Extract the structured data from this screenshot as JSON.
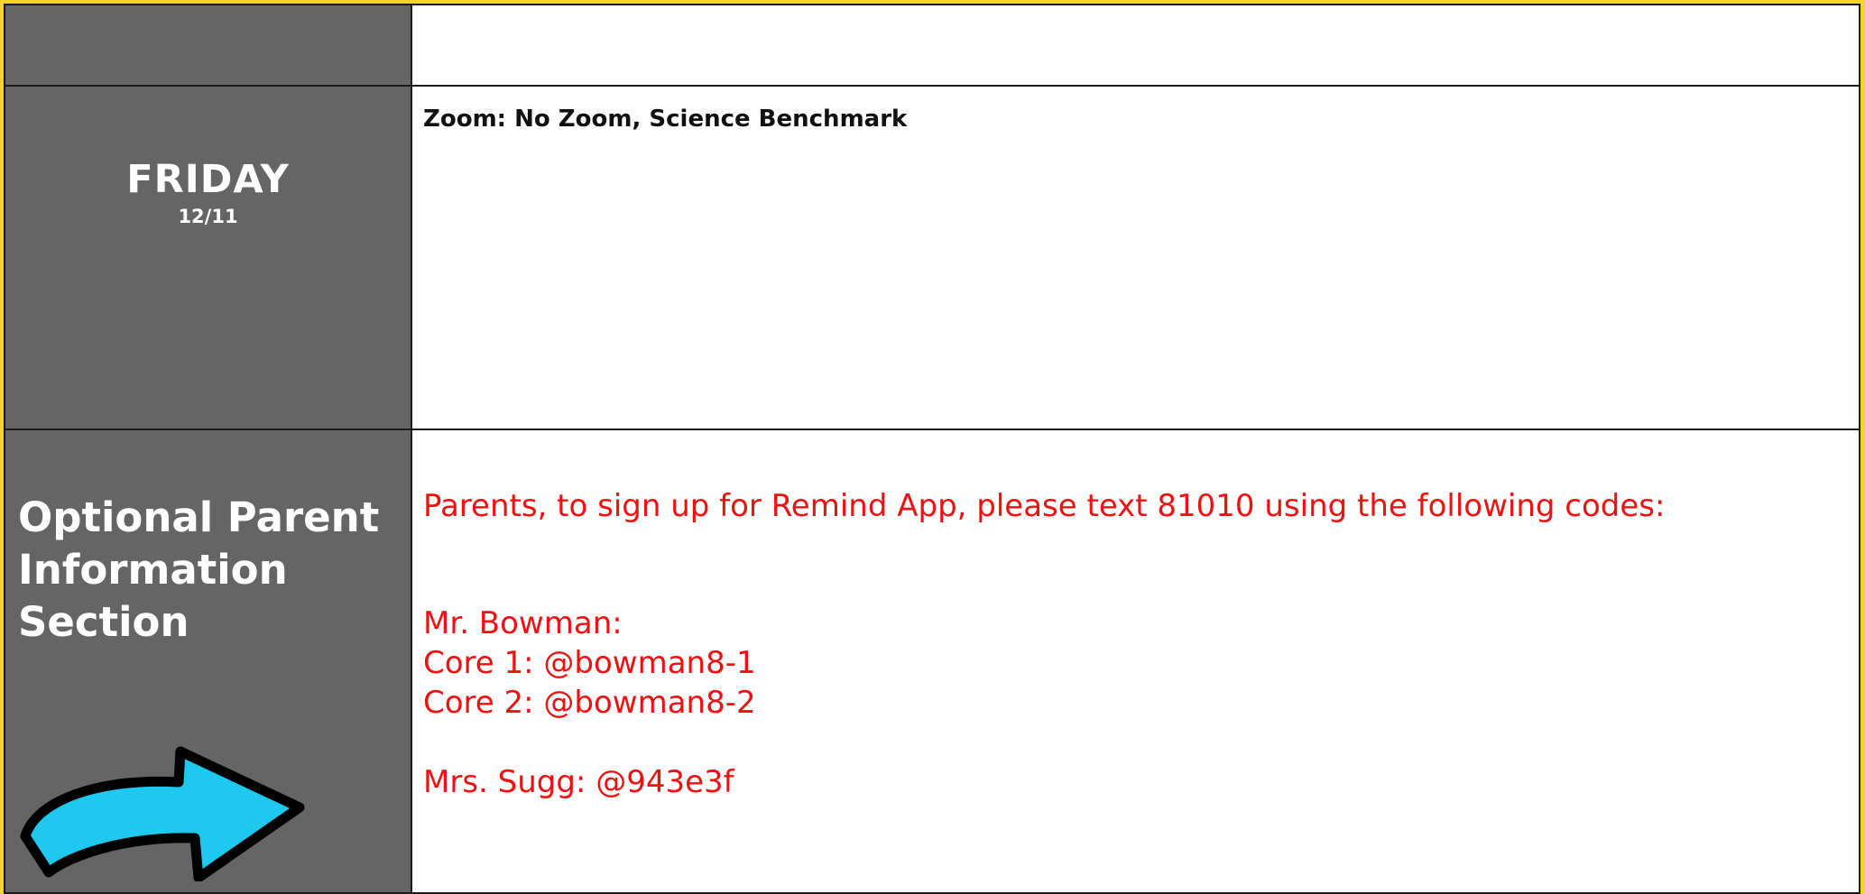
{
  "day": {
    "name": "FRIDAY",
    "date": "12/11"
  },
  "zoom_text": "Zoom: No Zoom, Science Benchmark",
  "parent_section": {
    "title_lines": [
      "Optional Parent",
      "Information",
      "Section"
    ],
    "arrow_icon": "right-curved-arrow-icon",
    "arrow_color": "#1ec8ef"
  },
  "info": {
    "intro": "Parents, to sign up for Remind App, please text 81010 using the following codes:",
    "teacher1": "Mr. Bowman:",
    "core1": "Core 1: @bowman8-1",
    "core2": "Core 2: @bowman8-2",
    "teacher2": "Mrs. Sugg: @943e3f"
  },
  "colors": {
    "frame": "#f5d327",
    "side": "#656565",
    "info_text": "#ee1111"
  }
}
